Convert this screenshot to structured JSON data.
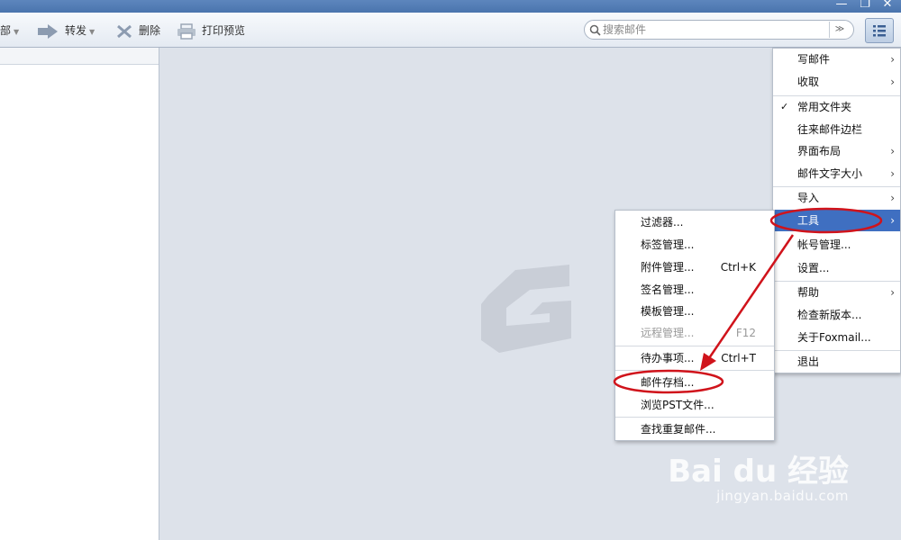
{
  "toolbar": {
    "reply_all_partial": "部",
    "forward": "转发",
    "delete": "删除",
    "print_preview": "打印预览"
  },
  "search": {
    "placeholder": "搜索邮件"
  },
  "main_menu": {
    "items": [
      {
        "label": "写邮件",
        "submenu": true
      },
      {
        "label": "收取",
        "submenu": true
      },
      {
        "label": "常用文件夹",
        "checked": true
      },
      {
        "label": "往来邮件边栏"
      },
      {
        "label": "界面布局",
        "submenu": true
      },
      {
        "label": "邮件文字大小",
        "submenu": true
      },
      {
        "label": "导入",
        "submenu": true
      },
      {
        "label": "工具",
        "submenu": true,
        "active": true
      },
      {
        "label": "帐号管理..."
      },
      {
        "label": "设置..."
      },
      {
        "label": "帮助",
        "submenu": true
      },
      {
        "label": "检查新版本..."
      },
      {
        "label": "关于Foxmail..."
      },
      {
        "label": "退出"
      }
    ]
  },
  "tools_menu": {
    "items": [
      {
        "label": "过滤器..."
      },
      {
        "label": "标签管理..."
      },
      {
        "label": "附件管理...",
        "shortcut": "Ctrl+K"
      },
      {
        "label": "签名管理..."
      },
      {
        "label": "模板管理..."
      },
      {
        "label": "远程管理...",
        "shortcut": "F12",
        "disabled": true
      },
      {
        "label": "待办事项...",
        "shortcut": "Ctrl+T"
      },
      {
        "label": "邮件存档...",
        "highlighted": true
      },
      {
        "label": "浏览PST文件..."
      },
      {
        "label": "查找重复邮件..."
      }
    ]
  },
  "watermark": {
    "main": "Bai du 经验",
    "sub": "jingyan.baidu.com"
  },
  "colors": {
    "accent": "#3f6fc1",
    "annotation": "#d0131b",
    "titlebar": "#4a74ad"
  }
}
